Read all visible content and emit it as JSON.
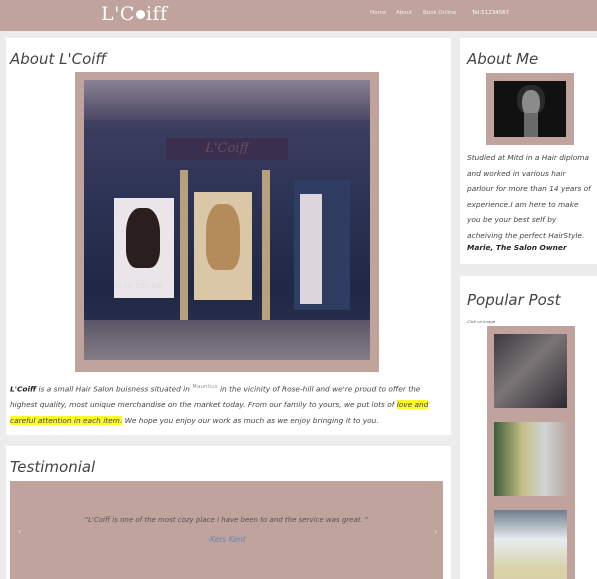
{
  "header": {
    "brand_left": "L'C",
    "brand_right": "iff",
    "nav": [
      "Home",
      "About",
      "Book Online"
    ],
    "tel": "Tel:51234567"
  },
  "about": {
    "title": "About L'Coiff",
    "photo_sign": "L'Coiff",
    "photo_label": "ELLA COLOR",
    "para_bold": "L'Coiff",
    "para_1": " is a small Hair Salon buisness situated in ",
    "para_sup": "Mauritius",
    "para_2": " in the vicinity of Rose-hill and we're proud to offer the highest quality, most unique merchandise on the market today. From our family to yours, we put lots of ",
    "para_highlight": "love and careful attention in each item.",
    "para_3": " We hope you enjoy our work as much as we enjoy bringing it to you."
  },
  "testimonial": {
    "title": "Testimonial",
    "quote": "\"L'Coiff is one of the most cozy place i have been to and the service was great. \"",
    "author": "-Kers Kent",
    "prev_glyph": "‹",
    "next_glyph": "›"
  },
  "about_me": {
    "title": "About Me",
    "bio": "Studied at Mitd in a Hair diploma and worked in various hair parlour for more than 14 years of experience.I am here to make you be your best self by acheiving the perfect HairStyle.",
    "signature": "Marie, The Salon Owner"
  },
  "popular": {
    "title": "Popular Post",
    "hint": "Click on Image"
  },
  "colors": {
    "accent": "#bfa39c",
    "highlight": "#fbfb2a",
    "link": "#6b86b5"
  }
}
